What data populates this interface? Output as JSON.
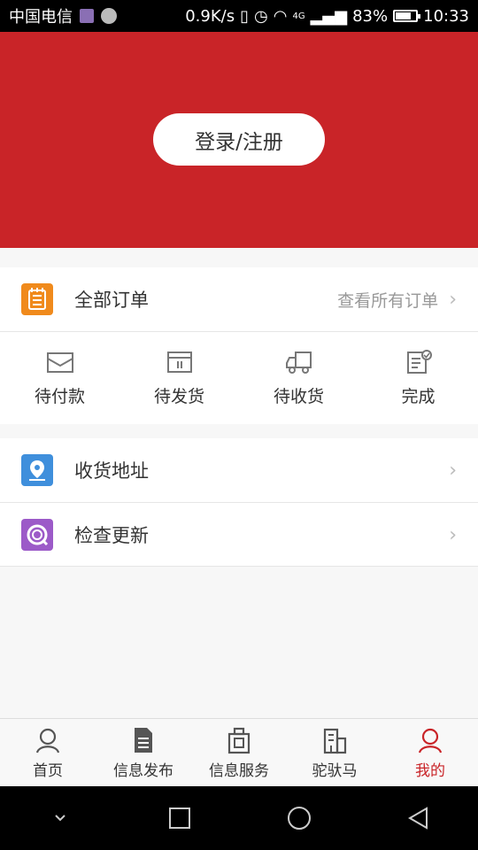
{
  "status_bar": {
    "carrier": "中国电信",
    "speed": "0.9K/s",
    "network": "4G",
    "battery": "83%",
    "battery_level": 0.83,
    "time": "10:33"
  },
  "header": {
    "login_label": "登录/注册"
  },
  "orders": {
    "title": "全部订单",
    "view_all": "查看所有订单",
    "items": [
      {
        "label": "待付款",
        "icon": "envelope-icon"
      },
      {
        "label": "待发货",
        "icon": "box-icon"
      },
      {
        "label": "待收货",
        "icon": "truck-icon"
      },
      {
        "label": "完成",
        "icon": "done-document-icon"
      }
    ]
  },
  "menu": [
    {
      "label": "收货地址",
      "icon": "location-pin-icon",
      "color": "#3f8fdc"
    },
    {
      "label": "检查更新",
      "icon": "refresh-icon",
      "color": "#9c5ac8"
    }
  ],
  "tabs": [
    {
      "label": "首页",
      "icon": "home-person-icon",
      "active": false
    },
    {
      "label": "信息发布",
      "icon": "document-icon",
      "active": false
    },
    {
      "label": "信息服务",
      "icon": "bag-icon",
      "active": false
    },
    {
      "label": "驼驮马",
      "icon": "building-icon",
      "active": false
    },
    {
      "label": "我的",
      "icon": "user-icon",
      "active": true
    }
  ],
  "colors": {
    "brand_red": "#c92428",
    "orders_icon": "#f08a1c"
  }
}
